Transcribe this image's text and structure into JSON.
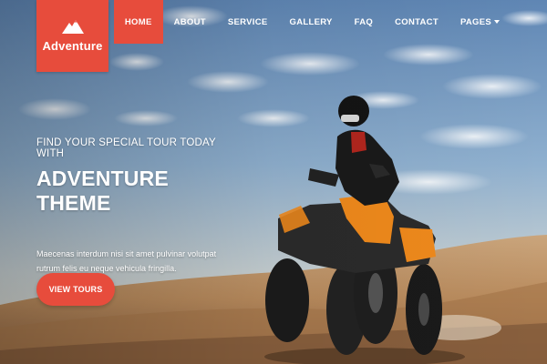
{
  "brand": {
    "name": "Adventure",
    "logo_icon": "mountain-icon",
    "accent_color": "#e74c3c"
  },
  "nav": {
    "items": [
      {
        "label": "HOME",
        "active": true
      },
      {
        "label": "ABOUT",
        "active": false
      },
      {
        "label": "SERVICE",
        "active": false
      },
      {
        "label": "GALLERY",
        "active": false
      },
      {
        "label": "FAQ",
        "active": false
      },
      {
        "label": "CONTACT",
        "active": false
      },
      {
        "label": "PAGES",
        "active": false,
        "dropdown": true
      }
    ]
  },
  "hero": {
    "eyebrow": "FIND YOUR SPECIAL TOUR TODAY WITH",
    "headline": "ADVENTURE THEME",
    "blurb": "Maecenas interdum nisi sit amet pulvinar volutpat rutrum felis eu neque vehicula fringilla.",
    "cta_label": "VIEW TOURS"
  }
}
